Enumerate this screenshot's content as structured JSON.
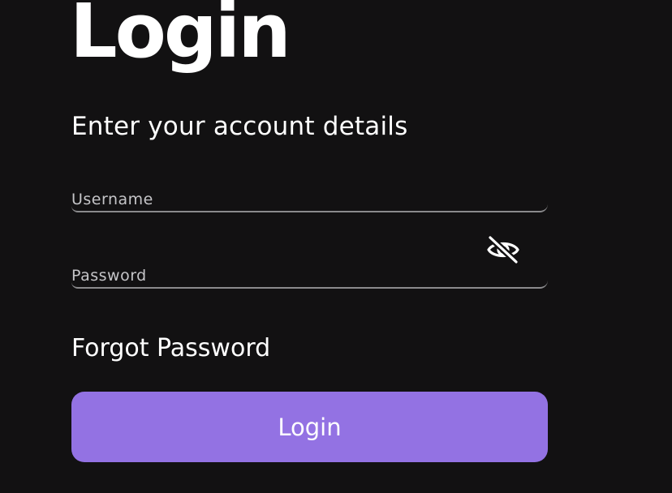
{
  "page": {
    "title": "Login",
    "subtitle": "Enter your account details"
  },
  "form": {
    "username": {
      "placeholder": "Username",
      "value": ""
    },
    "password": {
      "placeholder": "Password",
      "value": "",
      "visibility_icon": "eye-off-icon"
    },
    "forgot_password_label": "Forgot Password",
    "submit_label": "Login"
  },
  "colors": {
    "background": "#121112",
    "accent": "#9372e3",
    "text": "#ffffff",
    "field_underline": "#8a8a8c",
    "placeholder": "#c5c5c8"
  }
}
